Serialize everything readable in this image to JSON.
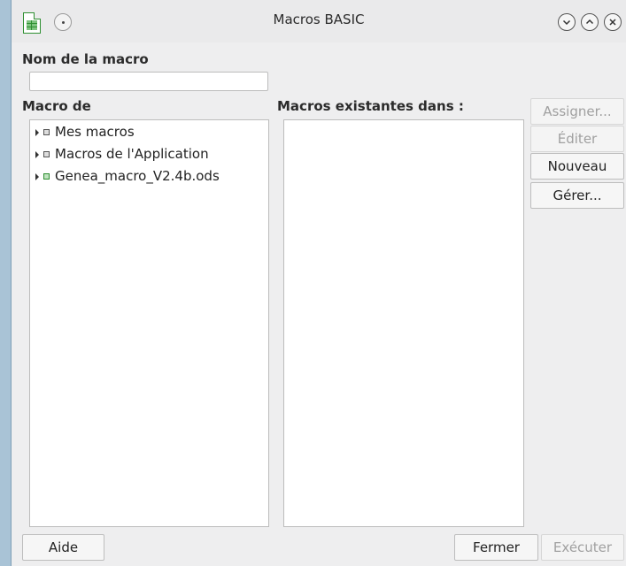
{
  "window": {
    "title": "Macros BASIC"
  },
  "labels": {
    "macro_name": "Nom de la macro",
    "macro_from": "Macro de",
    "existing_macros": "Macros existantes dans :"
  },
  "macro_name_input": {
    "value": "",
    "placeholder": ""
  },
  "tree": [
    {
      "label": "Mes macros",
      "icon": "library-icon"
    },
    {
      "label": "Macros de l'Application",
      "icon": "library-icon"
    },
    {
      "label": "Genea_macro_V2.4b.ods",
      "icon": "spreadsheet-icon"
    }
  ],
  "buttons": {
    "assign": "Assigner...",
    "edit": "Éditer",
    "new": "Nouveau",
    "manage": "Gérer...",
    "help": "Aide",
    "close": "Fermer",
    "run": "Exécuter"
  }
}
